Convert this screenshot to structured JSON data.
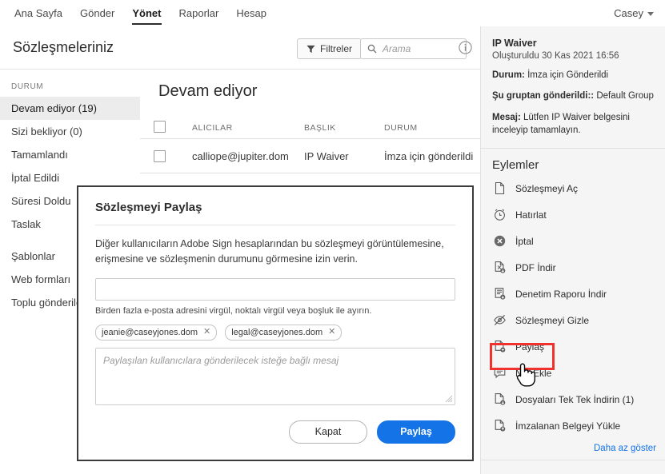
{
  "topnav": {
    "items": [
      {
        "label": "Ana Sayfa",
        "active": false
      },
      {
        "label": "Gönder",
        "active": false
      },
      {
        "label": "Yönet",
        "active": true
      },
      {
        "label": "Raporlar",
        "active": false
      },
      {
        "label": "Hesap",
        "active": false
      }
    ],
    "account_label": "Casey"
  },
  "header": {
    "title": "Sözleşmeleriniz",
    "filter_label": "Filtreler",
    "search_placeholder": "Arama",
    "search_value": ""
  },
  "sidebar": {
    "section_label": "DURUM",
    "items": [
      {
        "label": "Devam ediyor (19)",
        "selected": true
      },
      {
        "label": "Sizi bekliyor (0)",
        "selected": false
      },
      {
        "label": "Tamamlandı",
        "selected": false
      },
      {
        "label": "İptal Edildi",
        "selected": false
      },
      {
        "label": "Süresi Doldu",
        "selected": false
      },
      {
        "label": "Taslak",
        "selected": false
      }
    ],
    "items2": [
      {
        "label": "Şablonlar"
      },
      {
        "label": "Web formları"
      },
      {
        "label": "Toplu gönderiler"
      }
    ]
  },
  "main": {
    "list_title": "Devam ediyor",
    "columns": [
      "ALICILAR",
      "BAŞLIK",
      "DURUM"
    ],
    "rows": [
      {
        "recipient": "calliope@jupiter.dom",
        "title": "IP Waiver",
        "status": "İmza için gönderildi"
      }
    ]
  },
  "right_panel": {
    "doc_name": "IP Waiver",
    "created": "Oluşturuldu 30 Kas 2021 16:56",
    "status_label": "Durum:",
    "status_value": "İmza için Gönderildi",
    "group_label": "Şu gruptan gönderildi::",
    "group_value": "Default Group",
    "message_label": "Mesaj:",
    "message_value": "Lütfen IP Waiver belgesini inceleyip tamamlayın.",
    "actions_title": "Eylemler",
    "actions": [
      {
        "label": "Sözleşmeyi Aç",
        "icon": "document-icon"
      },
      {
        "label": "Hatırlat",
        "icon": "alarm-clock-icon"
      },
      {
        "label": "İptal",
        "icon": "cancel-circle-icon"
      },
      {
        "label": "PDF İndir",
        "icon": "pdf-download-icon"
      },
      {
        "label": "Denetim Raporu İndir",
        "icon": "report-download-icon"
      },
      {
        "label": "Sözleşmeyi Gizle",
        "icon": "eye-off-icon"
      },
      {
        "label": "Paylaş",
        "icon": "share-document-icon",
        "highlighted": true
      },
      {
        "label": "Not Ekle",
        "icon": "comment-icon"
      },
      {
        "label": "Dosyaları Tek Tek İndirin (1)",
        "icon": "download-file-icon"
      },
      {
        "label": "İmzalanan Belgeyi Yükle",
        "icon": "upload-file-icon"
      }
    ],
    "show_less": "Daha az göster"
  },
  "modal": {
    "title": "Sözleşmeyi Paylaş",
    "description": "Diğer kullanıcıların Adobe Sign hesaplarından bu sözleşmeyi görüntülemesine, erişmesine ve sözleşmenin durumunu görmesine izin verin.",
    "email_value": "",
    "hint": "Birden fazla e-posta adresini virgül, noktalı virgül veya boşluk ile ayırın.",
    "chips": [
      {
        "label": "jeanie@caseyjones.dom",
        "remove": "✕"
      },
      {
        "label": "legal@caseyjones.dom",
        "remove": "✕"
      }
    ],
    "message_placeholder": "Paylaşılan kullanıcılara gönderilecek isteğe bağlı mesaj",
    "message_value": "",
    "cancel_label": "Kapat",
    "submit_label": "Paylaş"
  },
  "colors": {
    "accent_blue": "#1473E6",
    "highlight_red": "#F0322E",
    "selected_bg": "#ECECEC"
  }
}
